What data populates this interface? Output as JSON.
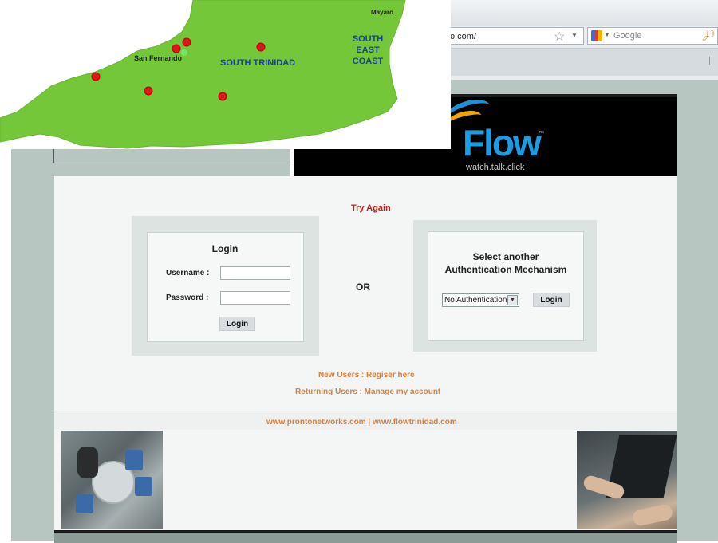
{
  "browser": {
    "url_fragment": "o.com/",
    "search_placeholder": "Google"
  },
  "map": {
    "town_label": "San Fernando",
    "region_label": "SOUTH TRINIDAD",
    "coast_label": [
      "SOUTH",
      "EAST",
      "COAST"
    ],
    "mayaro_label": "Mayaro"
  },
  "header": {
    "logo_text": "Flow",
    "logo_tm": "™",
    "tagline": "watch.talk.click"
  },
  "status": {
    "try_again": "Try Again"
  },
  "login": {
    "title": "Login",
    "username_label": "Username :",
    "password_label": "Password :",
    "submit_label": "Login"
  },
  "separator": "OR",
  "auth": {
    "title_line1": "Select another",
    "title_line2": "Authentication Mechanism",
    "selected_option": "No Authentication",
    "submit_label": "Login"
  },
  "links": {
    "new_users": "New Users : Regiser here",
    "returning_users": "Returning Users : Manage my account"
  },
  "footer": {
    "links": "www.prontonetworks.com | www.flowtrinidad.com"
  },
  "colors": {
    "try_again": "#c11d12",
    "link_orange": "#d97f3f",
    "map_green": "#74c739",
    "flow_blue": "#1a9de4"
  }
}
